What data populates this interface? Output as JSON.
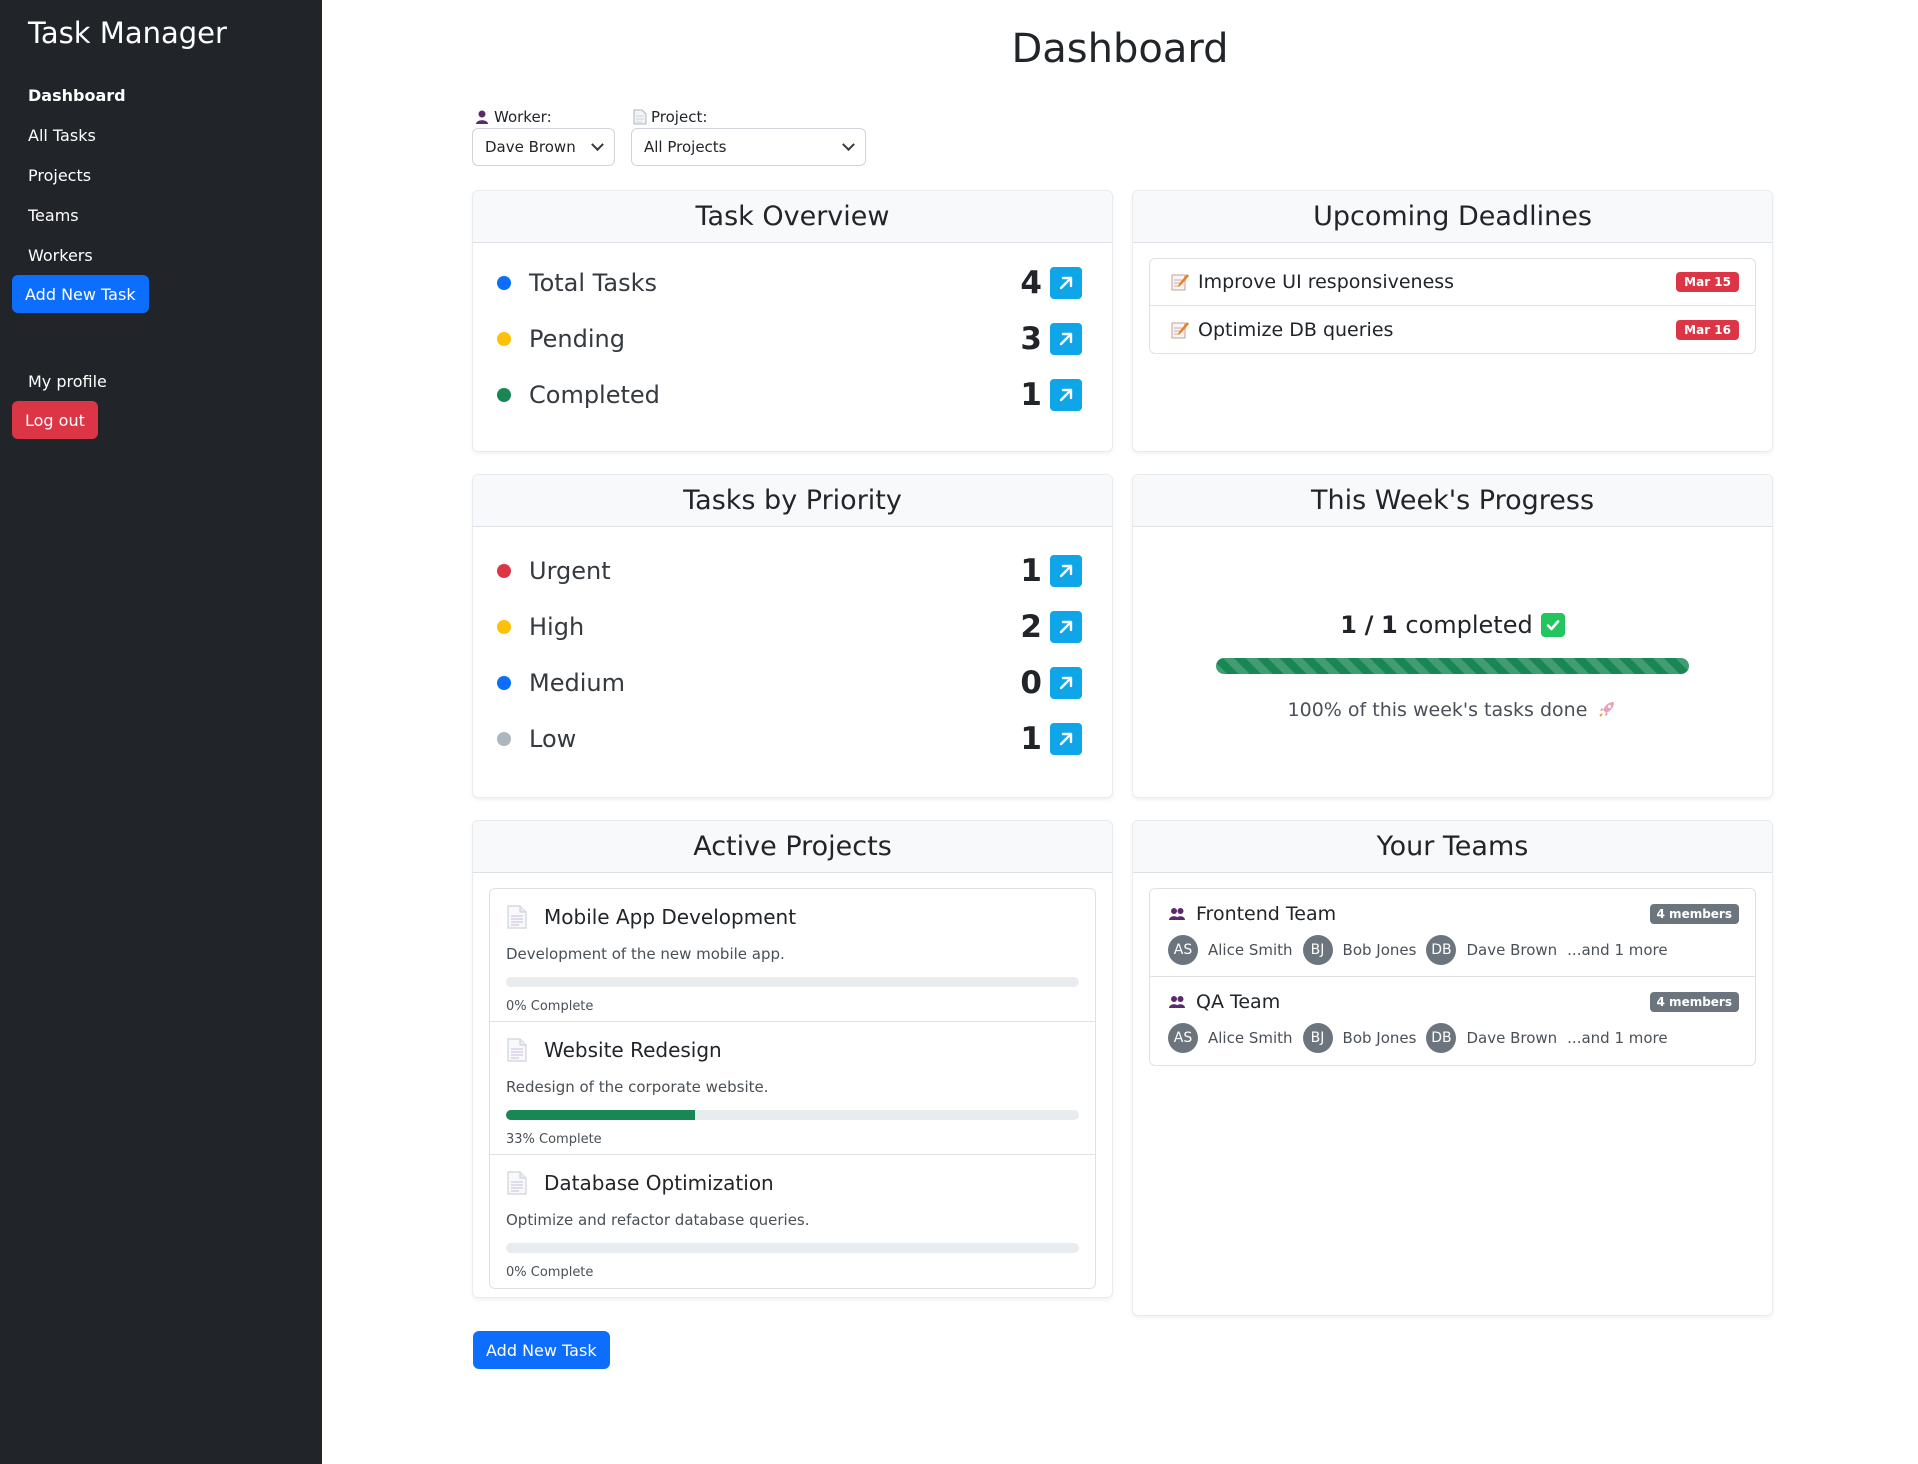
{
  "sidebar": {
    "brand": "Task Manager",
    "nav": [
      "Dashboard",
      "All Tasks",
      "Projects",
      "Teams",
      "Workers"
    ],
    "add_task": "Add New Task",
    "profile": "My profile",
    "logout": "Log out"
  },
  "page": {
    "title": "Dashboard"
  },
  "filters": {
    "worker_label": "Worker:",
    "worker_value": "Dave Brown",
    "project_label": "Project:",
    "project_value": "All Projects"
  },
  "task_overview": {
    "title": "Task Overview",
    "rows": [
      {
        "label": "Total Tasks",
        "count": "4",
        "color": "#0d6efd"
      },
      {
        "label": "Pending",
        "count": "3",
        "color": "#ffc107"
      },
      {
        "label": "Completed",
        "count": "1",
        "color": "#198754"
      }
    ]
  },
  "deadlines": {
    "title": "Upcoming Deadlines",
    "items": [
      {
        "text": "Improve UI responsiveness",
        "date": "Mar 15"
      },
      {
        "text": "Optimize DB queries",
        "date": "Mar 16"
      }
    ]
  },
  "priority": {
    "title": "Tasks by Priority",
    "rows": [
      {
        "label": "Urgent",
        "count": "1",
        "color": "#dc3545"
      },
      {
        "label": "High",
        "count": "2",
        "color": "#ffc107"
      },
      {
        "label": "Medium",
        "count": "0",
        "color": "#0d6efd"
      },
      {
        "label": "Low",
        "count": "1",
        "color": "#adb5bd"
      }
    ]
  },
  "weekly": {
    "title": "This Week's Progress",
    "completed": "1",
    "total": "1",
    "completed_word": "completed",
    "progress": 1.0,
    "summary": "100% of this week's tasks done"
  },
  "projects": {
    "title": "Active Projects",
    "items": [
      {
        "name": "Mobile App Development",
        "desc": "Development of the new mobile app.",
        "progress": 0,
        "pct_label": "0% Complete"
      },
      {
        "name": "Website Redesign",
        "desc": "Redesign of the corporate website.",
        "progress": 33,
        "pct_label": "33% Complete"
      },
      {
        "name": "Database Optimization",
        "desc": "Optimize and refactor database queries.",
        "progress": 0,
        "pct_label": "0% Complete"
      }
    ]
  },
  "teams": {
    "title": "Your Teams",
    "items": [
      {
        "name": "Frontend Team",
        "badge": "4 members",
        "members": [
          {
            "initials": "AS",
            "name": "Alice Smith"
          },
          {
            "initials": "BJ",
            "name": "Bob Jones"
          },
          {
            "initials": "DB",
            "name": "Dave Brown"
          }
        ],
        "more": "...and 1 more"
      },
      {
        "name": "QA Team",
        "badge": "4 members",
        "members": [
          {
            "initials": "AS",
            "name": "Alice Smith"
          },
          {
            "initials": "BJ",
            "name": "Bob Jones"
          },
          {
            "initials": "DB",
            "name": "Dave Brown"
          }
        ],
        "more": "...and 1 more"
      }
    ]
  },
  "footer": {
    "add_task": "Add New Task"
  }
}
